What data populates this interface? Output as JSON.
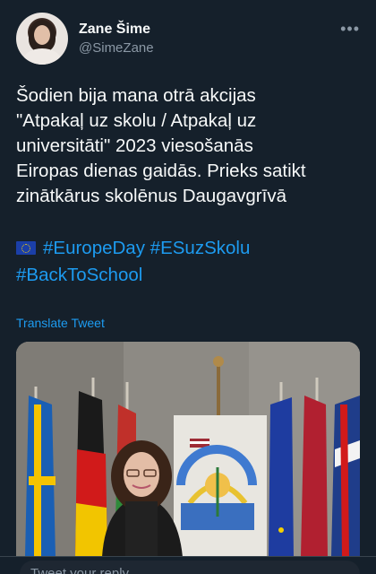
{
  "author": {
    "name": "Zane Šime",
    "handle": "@SimeZane"
  },
  "tweet": {
    "text_lines": [
      "Šodien bija mana otrā akcijas",
      "\"Atpakaļ uz skolu / Atpakaļ uz",
      "universitāti\" 2023 viesošanās",
      "Eiropas dienas gaidās. Prieks satikt",
      "zinātkārus skolēnus Daugavgrīvā"
    ],
    "hashtags": [
      "#EuropeDay",
      "#ESuzSkolu",
      "#BackToSchool"
    ],
    "translate_label": "Translate Tweet"
  },
  "media": {
    "description_icon": "photo-woman-flags"
  },
  "reply": {
    "placeholder": "Tweet your reply"
  },
  "icons": {
    "more": "more-horizontal-icon",
    "flag": "eu-flag-icon"
  },
  "colors": {
    "background": "#15202b",
    "accent": "#1d9bf0",
    "secondary_text": "#8b98a5"
  }
}
